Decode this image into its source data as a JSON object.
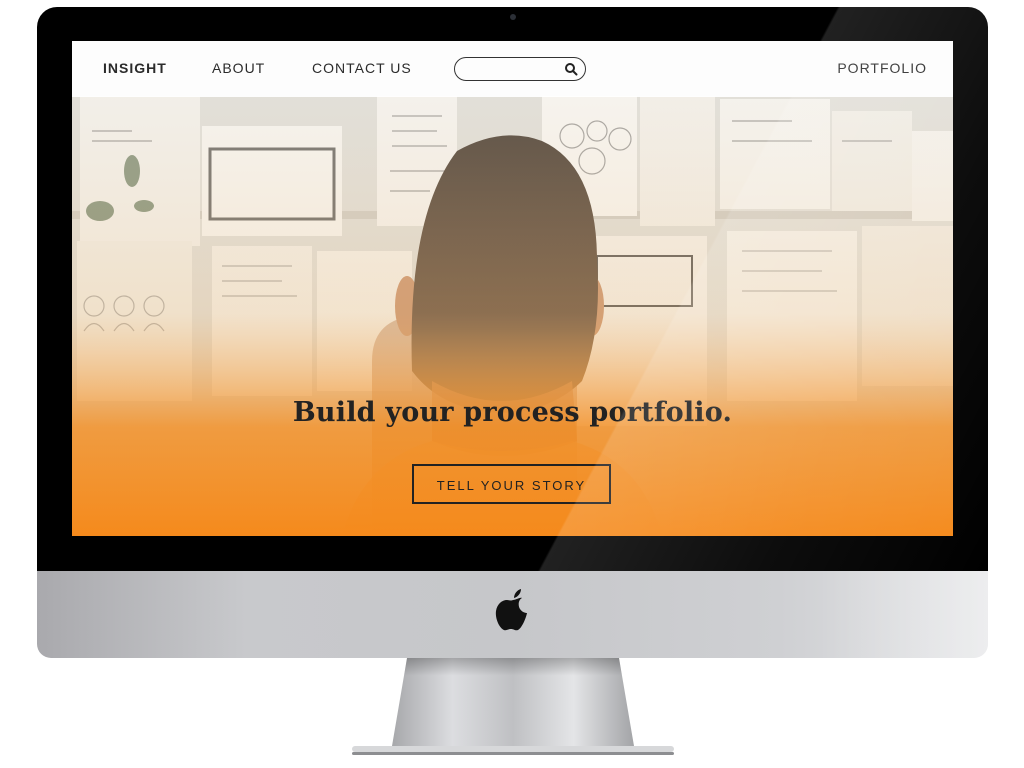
{
  "site": {
    "nav": {
      "brand": "INSIGHT",
      "about": "ABOUT",
      "contact": "CONTACT US",
      "portfolio": "PORTFOLIO",
      "search_value": ""
    },
    "hero": {
      "title": "Build your process portfolio.",
      "cta_label": "TELL YOUR STORY"
    }
  },
  "colors": {
    "accent_orange": "#f39026",
    "bezel": "#000000",
    "text_dark": "#222222"
  },
  "icons": {
    "search": "search-icon",
    "apple": "apple-logo-icon"
  }
}
